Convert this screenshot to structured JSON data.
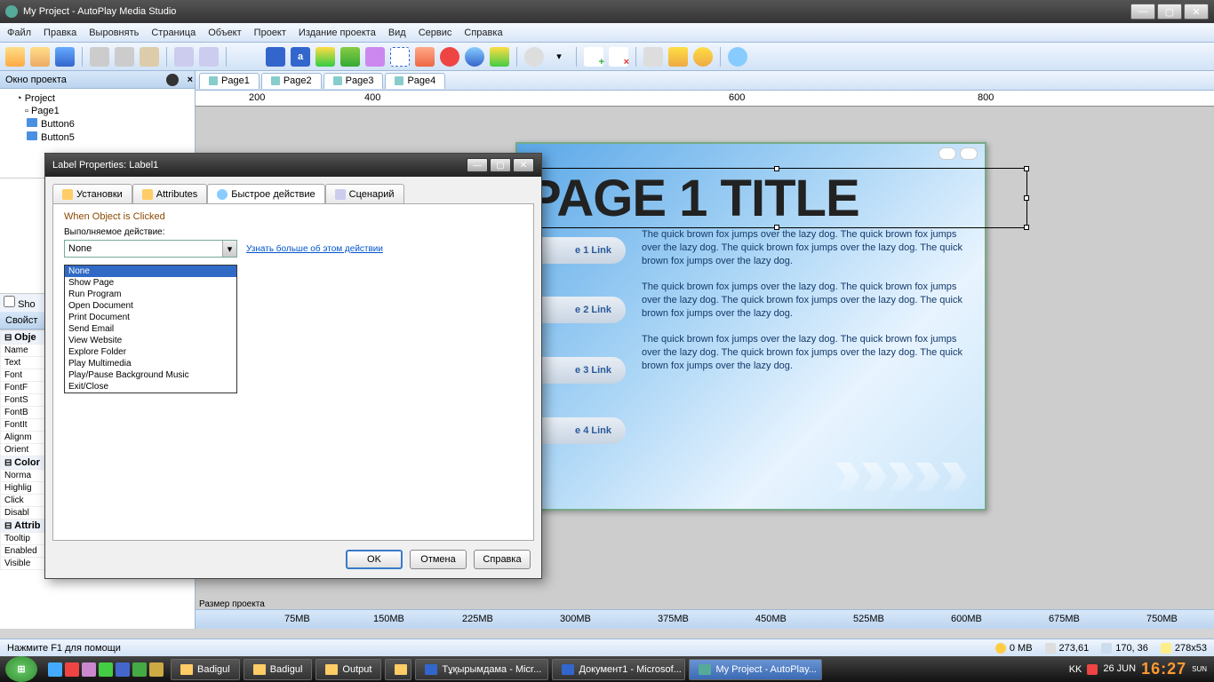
{
  "window": {
    "title": "My Project - AutoPlay Media Studio"
  },
  "menu": [
    "Файл",
    "Правка",
    "Выровнять",
    "Страница",
    "Объект",
    "Проект",
    "Издание проекта",
    "Вид",
    "Сервис",
    "Справка"
  ],
  "leftpanel": {
    "project_hdr": "Окно проекта",
    "tree_root": "Project",
    "tree_page": "Page1",
    "tree_items": [
      "Button6",
      "Button5"
    ],
    "show_hidden": "Sho",
    "props_hdr": "Свойст",
    "cats": {
      "obj": "Obje",
      "colors": "Color",
      "attrib": "Attrib"
    },
    "rows": [
      [
        "Name",
        ""
      ],
      [
        "Text",
        ""
      ],
      [
        "Font",
        ""
      ],
      [
        "FontF",
        ""
      ],
      [
        "FontS",
        ""
      ],
      [
        "FontB",
        ""
      ],
      [
        "FontIt",
        ""
      ],
      [
        "Alignm",
        ""
      ],
      [
        "Orient",
        ""
      ],
      [
        "Norma",
        ""
      ],
      [
        "Highlig",
        ""
      ],
      [
        "Click",
        ""
      ],
      [
        "Disabl",
        ""
      ],
      [
        "Tooltip",
        ""
      ],
      [
        "Enabled",
        "True"
      ],
      [
        "Visible",
        "True"
      ]
    ]
  },
  "tabs": [
    "Page1",
    "Page2",
    "Page3",
    "Page4"
  ],
  "ruler_marks": [
    "200",
    "400",
    "600",
    "800"
  ],
  "page": {
    "title": "PAGE 1 TITLE",
    "links": [
      "e 1 Link",
      "e 2 Link",
      "e 3 Link",
      "e 4 Link"
    ],
    "paragraph": "The quick brown fox jumps over the lazy dog. The quick brown fox jumps over the lazy dog. The quick brown fox jumps over the lazy dog. The quick brown fox jumps over the lazy dog."
  },
  "sizebar": {
    "label": "Размер проекта",
    "marks": [
      "75MB",
      "150MB",
      "225MB",
      "300MB",
      "375MB",
      "450MB",
      "525MB",
      "600MB",
      "675MB",
      "750MB"
    ]
  },
  "dialog": {
    "title": "Label Properties: Label1",
    "tabs": [
      "Установки",
      "Attributes",
      "Быстрое действие",
      "Сценарий"
    ],
    "section": "When Object is Clicked",
    "field_label": "Выполняемое действие:",
    "selected": "None",
    "link": "Узнать больше об этом действии",
    "options": [
      "None",
      "Show Page",
      "Run Program",
      "Open Document",
      "Print Document",
      "Send Email",
      "View Website",
      "Explore Folder",
      "Play Multimedia",
      "Play/Pause Background Music",
      "Exit/Close"
    ],
    "buttons": {
      "ok": "OK",
      "cancel": "Отмена",
      "help": "Справка"
    }
  },
  "status": {
    "help": "Нажмите F1 для помощи",
    "mem": "0 MB",
    "coord1": "273,61",
    "coord2": "170, 36",
    "size": "278x53"
  },
  "taskbar": {
    "tasks": [
      "Badigul",
      "Badigul",
      "Output",
      "",
      "Тұқырымдама - Micr...",
      "Документ1 - Microsof...",
      "My Project - AutoPlay..."
    ],
    "lang": "KK",
    "date": "26 JUN",
    "time": "16:27",
    "day": "SUN"
  }
}
